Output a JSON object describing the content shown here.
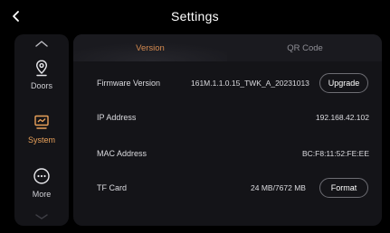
{
  "header": {
    "title": "Settings",
    "back_icon": "chevron-left-icon"
  },
  "colors": {
    "background": "#000000",
    "surface": "#141418",
    "accent": "#e9a15a",
    "active_tab": "#d58a4f",
    "text": "#ffffff",
    "muted": "#8f8f96"
  },
  "sidebar": {
    "scroll_up_icon": "chevron-up-icon",
    "scroll_down_icon": "chevron-down-icon",
    "items": [
      {
        "label": "Doors",
        "icon": "location-pin-icon",
        "active": false
      },
      {
        "label": "System",
        "icon": "monitor-icon",
        "active": true
      },
      {
        "label": "More",
        "icon": "more-horizontal-icon",
        "active": false
      }
    ]
  },
  "tabs": [
    {
      "label": "Version",
      "active": true
    },
    {
      "label": "QR Code",
      "active": false
    }
  ],
  "rows": [
    {
      "label": "Firmware Version",
      "value": "161M.1.1.0.15_TWK_A_20231013",
      "button": "Upgrade"
    },
    {
      "label": "IP Address",
      "value": "192.168.42.102"
    },
    {
      "label": "MAC Address",
      "value": "BC:F8:11:52:FE:EE"
    },
    {
      "label": "TF Card",
      "value": "24 MB/7672 MB",
      "button": "Format"
    }
  ]
}
